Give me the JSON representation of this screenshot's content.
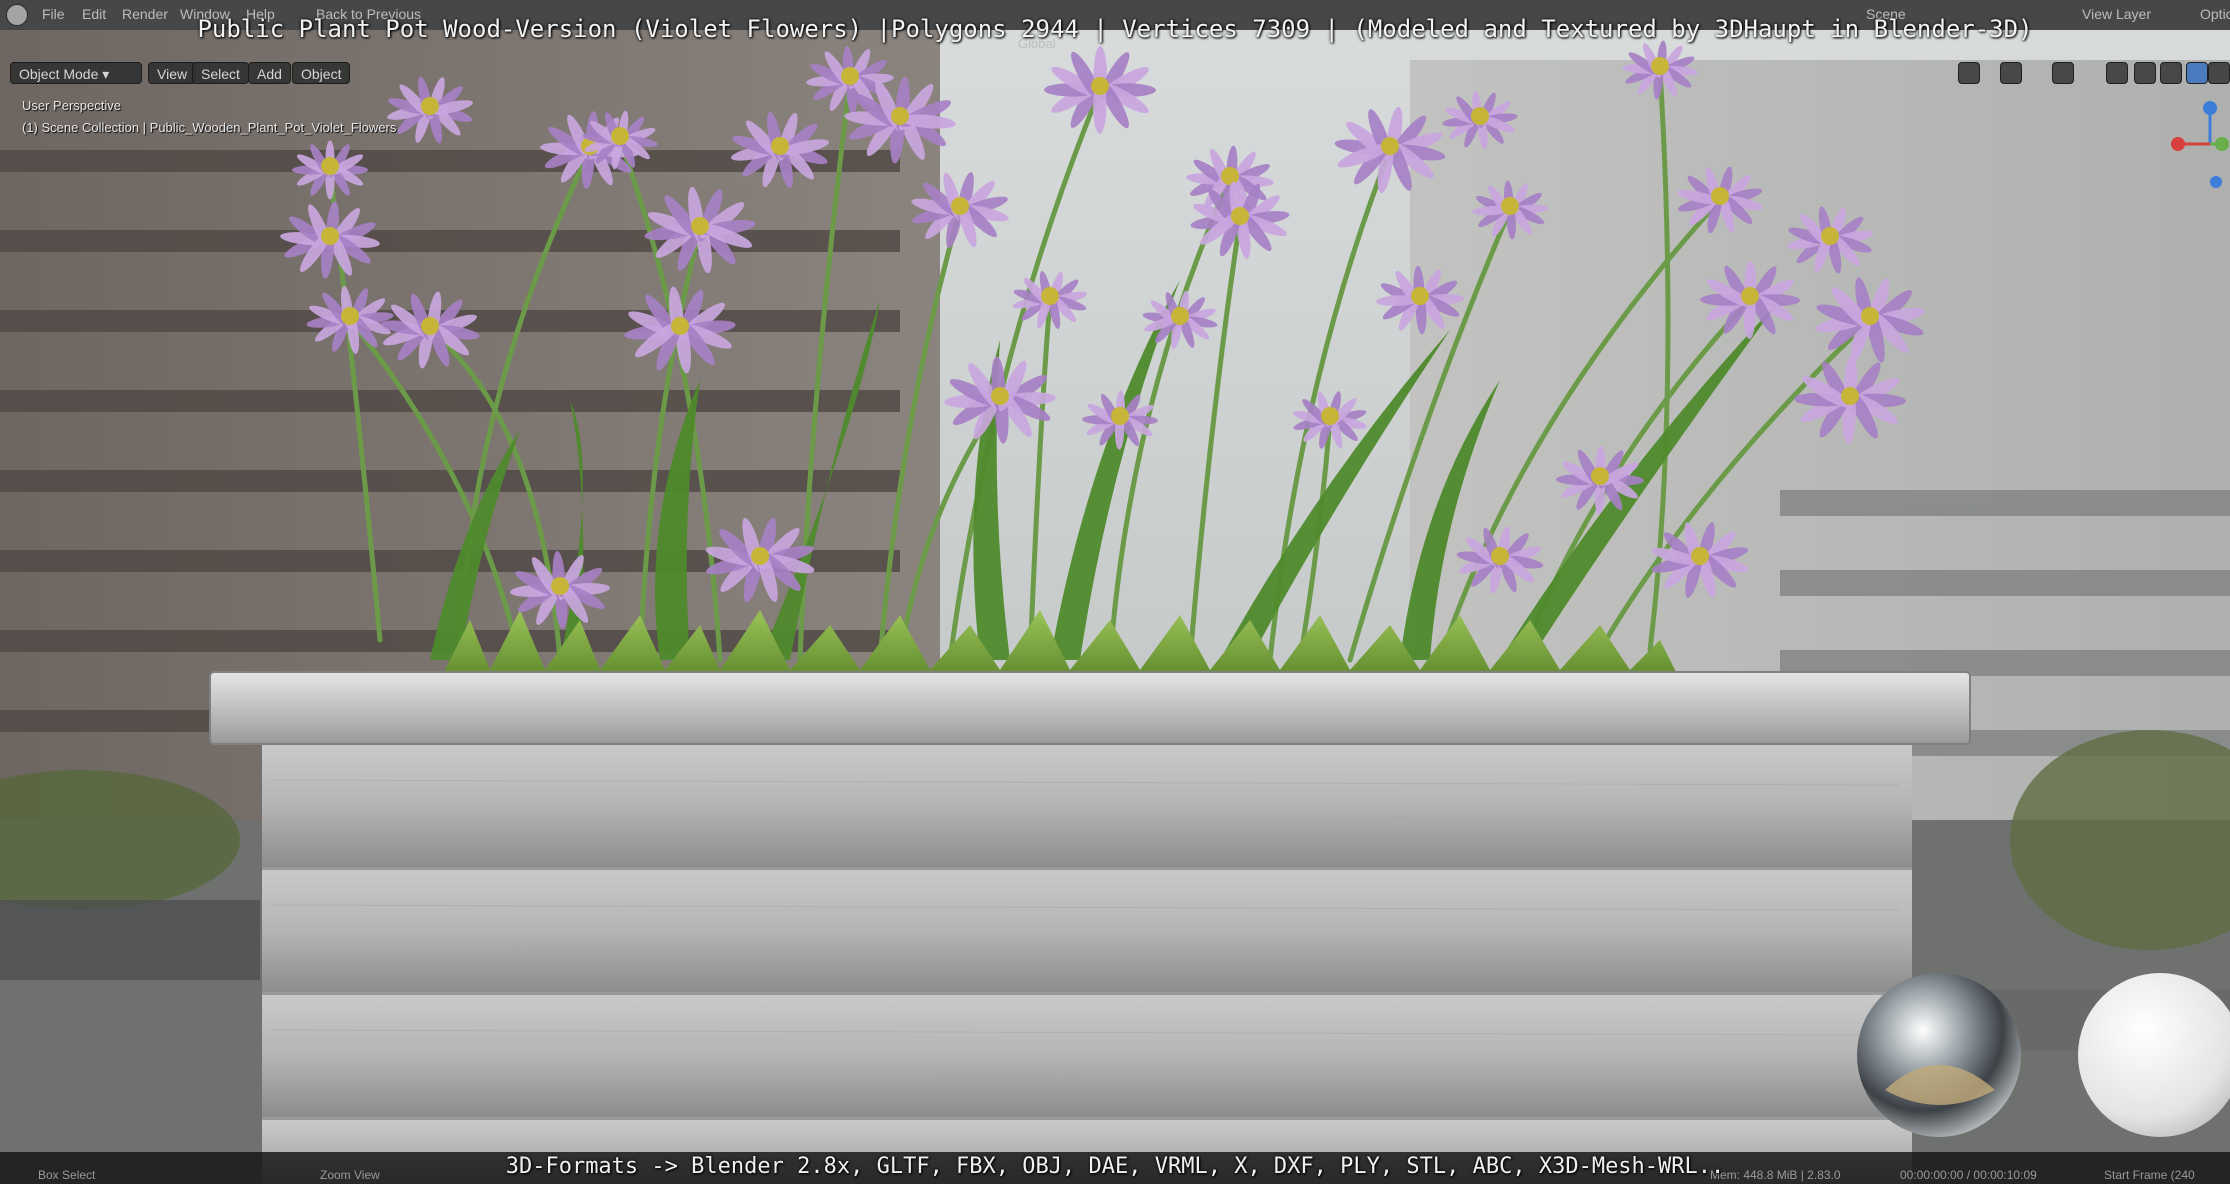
{
  "window": {
    "overlay_title": "Public Plant Pot Wood-Version (Violet Flowers) |Polygons 2944 | Vertices 7309 | (Modeled and Textured by 3DHaupt in Blender-3D)",
    "overlay_formats": "3D-Formats -> Blender 2.8x, GLTF, FBX, OBJ, DAE, VRML, X, DXF, PLY, STL, ABC, X3D-Mesh-WRL.."
  },
  "topbar": {
    "menus": [
      "File",
      "Edit",
      "Render",
      "Window",
      "Help"
    ],
    "back_button": "Back to Previous",
    "scene_label": "Scene",
    "view_layer_label": "View Layer",
    "options_label": "Optio"
  },
  "viewport_header": {
    "mode": "Object Mode",
    "menus": [
      "View",
      "Select",
      "Add",
      "Object"
    ],
    "transform_orientation": "Global"
  },
  "viewport_info": {
    "perspective": "User Perspective",
    "collection": "(1) Scene Collection | Public_Wooden_Plant_Pot_Violet_Flowers"
  },
  "statusbar": {
    "left": "Box Select",
    "middle": "Zoom View",
    "mem": "Mem: 448.8 MiB | 2.83.0",
    "time": "00:00:00:00 / 00:00:10:09",
    "frame": "Start Frame (240"
  },
  "icons": {
    "blender_logo": "blender-logo-icon",
    "gizmo": "navigation-gizmo-icon",
    "shading": "viewport-shading-icon"
  },
  "colors": {
    "petal": "#c9a6de",
    "petal_dark": "#a680c4",
    "stem": "#5d8f3c",
    "pot_light": "#cfcfcf",
    "pot_dark": "#8f8f8f"
  }
}
